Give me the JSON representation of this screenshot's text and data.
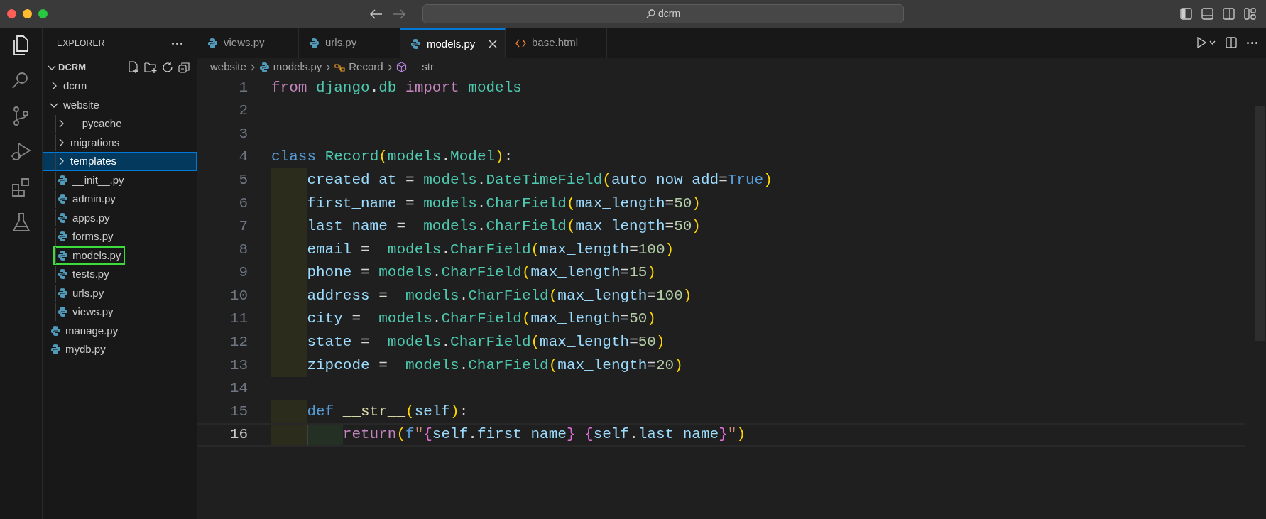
{
  "title_bar": {
    "search": "dcrm"
  },
  "activity_bar": [
    {
      "kind": "files",
      "selected": true
    },
    {
      "kind": "search",
      "selected": false
    },
    {
      "kind": "source-control",
      "selected": false
    },
    {
      "kind": "debug",
      "selected": false
    },
    {
      "kind": "extensions",
      "selected": false
    },
    {
      "kind": "testing",
      "selected": false
    }
  ],
  "sidebar": {
    "title": "EXPLORER",
    "section": {
      "label": "DCRM",
      "expanded": true
    },
    "tree": [
      {
        "kind": "folder",
        "label": "dcrm",
        "expanded": false,
        "selected": false
      },
      {
        "kind": "folder",
        "label": "website",
        "expanded": true,
        "selected": false,
        "children": [
          {
            "kind": "folder",
            "label": "__pycache__",
            "expanded": false,
            "selected": false
          },
          {
            "kind": "folder",
            "label": "migrations",
            "expanded": false,
            "selected": false
          },
          {
            "kind": "folder",
            "label": "templates",
            "expanded": false,
            "selected": true
          },
          {
            "kind": "python",
            "label": "__init__.py",
            "selected": false
          },
          {
            "kind": "python",
            "label": "admin.py",
            "selected": false
          },
          {
            "kind": "python",
            "label": "apps.py",
            "selected": false
          },
          {
            "kind": "python",
            "label": "forms.py",
            "selected": false
          },
          {
            "kind": "python",
            "label": "models.py",
            "selected": false,
            "outlined": true
          },
          {
            "kind": "python",
            "label": "tests.py",
            "selected": false
          },
          {
            "kind": "python",
            "label": "urls.py",
            "selected": false
          },
          {
            "kind": "python",
            "label": "views.py",
            "selected": false
          }
        ]
      },
      {
        "kind": "python",
        "label": "manage.py",
        "selected": false
      },
      {
        "kind": "python",
        "label": "mydb.py",
        "selected": false
      }
    ]
  },
  "tabs": [
    {
      "kind": "python",
      "label": "views.py",
      "selected": false
    },
    {
      "kind": "python",
      "label": "urls.py",
      "selected": false
    },
    {
      "kind": "python",
      "label": "models.py",
      "selected": true
    },
    {
      "kind": "html",
      "label": "base.html",
      "selected": false
    }
  ],
  "breadcrumb": [
    {
      "kind": "folder",
      "label": "website"
    },
    {
      "kind": "python",
      "label": "models.py"
    },
    {
      "kind": "class",
      "label": "Record"
    },
    {
      "kind": "method",
      "label": "__str__"
    }
  ],
  "code": [
    {
      "number": "1",
      "current": false,
      "guide": false,
      "inner_guide": false,
      "tokens": [
        {
          "kind": "kw",
          "text": "from "
        },
        {
          "kind": "mod",
          "text": "django"
        },
        {
          "kind": "op",
          "text": "."
        },
        {
          "kind": "mod",
          "text": "db "
        },
        {
          "kind": "kw",
          "text": "import "
        },
        {
          "kind": "mod",
          "text": "models"
        }
      ]
    },
    {
      "number": "2",
      "current": false,
      "guide": false,
      "inner_guide": false
    },
    {
      "number": "3",
      "current": false,
      "guide": false,
      "inner_guide": false
    },
    {
      "number": "4",
      "current": false,
      "guide": false,
      "inner_guide": false,
      "tokens": [
        {
          "kind": "kw2",
          "text": "class "
        },
        {
          "kind": "mod",
          "text": "Record"
        },
        {
          "kind": "br1",
          "text": "("
        },
        {
          "kind": "mod",
          "text": "models"
        },
        {
          "kind": "op",
          "text": "."
        },
        {
          "kind": "mod",
          "text": "Model"
        },
        {
          "kind": "br1",
          "text": ")"
        },
        {
          "kind": "op",
          "text": ":"
        }
      ]
    },
    {
      "number": "5",
      "current": false,
      "guide": true,
      "inner_guide": false,
      "tokens": [
        {
          "kind": "var",
          "text": "created_at"
        },
        {
          "kind": "op",
          "text": " = "
        },
        {
          "kind": "mod",
          "text": "models"
        },
        {
          "kind": "op",
          "text": "."
        },
        {
          "kind": "mod",
          "text": "DateTimeField"
        },
        {
          "kind": "br1",
          "text": "("
        },
        {
          "kind": "var",
          "text": "auto_now_add"
        },
        {
          "kind": "op",
          "text": "="
        },
        {
          "kind": "kw2",
          "text": "True"
        },
        {
          "kind": "br1",
          "text": ")"
        }
      ]
    },
    {
      "number": "6",
      "current": false,
      "guide": true,
      "inner_guide": false,
      "tokens": [
        {
          "kind": "var",
          "text": "first_name"
        },
        {
          "kind": "op",
          "text": " = "
        },
        {
          "kind": "mod",
          "text": "models"
        },
        {
          "kind": "op",
          "text": "."
        },
        {
          "kind": "mod",
          "text": "CharField"
        },
        {
          "kind": "br1",
          "text": "("
        },
        {
          "kind": "var",
          "text": "max_length"
        },
        {
          "kind": "op",
          "text": "="
        },
        {
          "kind": "num",
          "text": "50"
        },
        {
          "kind": "br1",
          "text": ")"
        }
      ]
    },
    {
      "number": "7",
      "current": false,
      "guide": true,
      "inner_guide": false,
      "tokens": [
        {
          "kind": "var",
          "text": "last_name"
        },
        {
          "kind": "op",
          "text": " =  "
        },
        {
          "kind": "mod",
          "text": "models"
        },
        {
          "kind": "op",
          "text": "."
        },
        {
          "kind": "mod",
          "text": "CharField"
        },
        {
          "kind": "br1",
          "text": "("
        },
        {
          "kind": "var",
          "text": "max_length"
        },
        {
          "kind": "op",
          "text": "="
        },
        {
          "kind": "num",
          "text": "50"
        },
        {
          "kind": "br1",
          "text": ")"
        }
      ]
    },
    {
      "number": "8",
      "current": false,
      "guide": true,
      "inner_guide": false,
      "tokens": [
        {
          "kind": "var",
          "text": "email"
        },
        {
          "kind": "op",
          "text": " =  "
        },
        {
          "kind": "mod",
          "text": "models"
        },
        {
          "kind": "op",
          "text": "."
        },
        {
          "kind": "mod",
          "text": "CharField"
        },
        {
          "kind": "br1",
          "text": "("
        },
        {
          "kind": "var",
          "text": "max_length"
        },
        {
          "kind": "op",
          "text": "="
        },
        {
          "kind": "num",
          "text": "100"
        },
        {
          "kind": "br1",
          "text": ")"
        }
      ]
    },
    {
      "number": "9",
      "current": false,
      "guide": true,
      "inner_guide": false,
      "tokens": [
        {
          "kind": "var",
          "text": "phone"
        },
        {
          "kind": "op",
          "text": " = "
        },
        {
          "kind": "mod",
          "text": "models"
        },
        {
          "kind": "op",
          "text": "."
        },
        {
          "kind": "mod",
          "text": "CharField"
        },
        {
          "kind": "br1",
          "text": "("
        },
        {
          "kind": "var",
          "text": "max_length"
        },
        {
          "kind": "op",
          "text": "="
        },
        {
          "kind": "num",
          "text": "15"
        },
        {
          "kind": "br1",
          "text": ")"
        }
      ]
    },
    {
      "number": "10",
      "current": false,
      "guide": true,
      "inner_guide": false,
      "tokens": [
        {
          "kind": "var",
          "text": "address"
        },
        {
          "kind": "op",
          "text": " =  "
        },
        {
          "kind": "mod",
          "text": "models"
        },
        {
          "kind": "op",
          "text": "."
        },
        {
          "kind": "mod",
          "text": "CharField"
        },
        {
          "kind": "br1",
          "text": "("
        },
        {
          "kind": "var",
          "text": "max_length"
        },
        {
          "kind": "op",
          "text": "="
        },
        {
          "kind": "num",
          "text": "100"
        },
        {
          "kind": "br1",
          "text": ")"
        }
      ]
    },
    {
      "number": "11",
      "current": false,
      "guide": true,
      "inner_guide": false,
      "tokens": [
        {
          "kind": "var",
          "text": "city"
        },
        {
          "kind": "op",
          "text": " =  "
        },
        {
          "kind": "mod",
          "text": "models"
        },
        {
          "kind": "op",
          "text": "."
        },
        {
          "kind": "mod",
          "text": "CharField"
        },
        {
          "kind": "br1",
          "text": "("
        },
        {
          "kind": "var",
          "text": "max_length"
        },
        {
          "kind": "op",
          "text": "="
        },
        {
          "kind": "num",
          "text": "50"
        },
        {
          "kind": "br1",
          "text": ")"
        }
      ]
    },
    {
      "number": "12",
      "current": false,
      "guide": true,
      "inner_guide": false,
      "tokens": [
        {
          "kind": "var",
          "text": "state"
        },
        {
          "kind": "op",
          "text": " =  "
        },
        {
          "kind": "mod",
          "text": "models"
        },
        {
          "kind": "op",
          "text": "."
        },
        {
          "kind": "mod",
          "text": "CharField"
        },
        {
          "kind": "br1",
          "text": "("
        },
        {
          "kind": "var",
          "text": "max_length"
        },
        {
          "kind": "op",
          "text": "="
        },
        {
          "kind": "num",
          "text": "50"
        },
        {
          "kind": "br1",
          "text": ")"
        }
      ]
    },
    {
      "number": "13",
      "current": false,
      "guide": true,
      "inner_guide": false,
      "tokens": [
        {
          "kind": "var",
          "text": "zipcode"
        },
        {
          "kind": "op",
          "text": " =  "
        },
        {
          "kind": "mod",
          "text": "models"
        },
        {
          "kind": "op",
          "text": "."
        },
        {
          "kind": "mod",
          "text": "CharField"
        },
        {
          "kind": "br1",
          "text": "("
        },
        {
          "kind": "var",
          "text": "max_length"
        },
        {
          "kind": "op",
          "text": "="
        },
        {
          "kind": "num",
          "text": "20"
        },
        {
          "kind": "br1",
          "text": ")"
        }
      ]
    },
    {
      "number": "14",
      "current": false,
      "guide": false,
      "inner_guide": false
    },
    {
      "number": "15",
      "current": false,
      "guide": true,
      "inner_guide": false,
      "tokens": [
        {
          "kind": "kw2",
          "text": "def "
        },
        {
          "kind": "fn",
          "text": "__str__"
        },
        {
          "kind": "br1",
          "text": "("
        },
        {
          "kind": "var",
          "text": "self"
        },
        {
          "kind": "br1",
          "text": ")"
        },
        {
          "kind": "op",
          "text": ":"
        }
      ]
    },
    {
      "number": "16",
      "current": true,
      "guide": true,
      "inner_guide": true,
      "tokens": [
        {
          "kind": "kw",
          "text": "return"
        },
        {
          "kind": "br1",
          "text": "("
        },
        {
          "kind": "kw2",
          "text": "f"
        },
        {
          "kind": "str",
          "text": "\""
        },
        {
          "kind": "br2",
          "text": "{"
        },
        {
          "kind": "var",
          "text": "self"
        },
        {
          "kind": "op",
          "text": "."
        },
        {
          "kind": "var",
          "text": "first_name"
        },
        {
          "kind": "br2",
          "text": "} {"
        },
        {
          "kind": "var",
          "text": "self"
        },
        {
          "kind": "op",
          "text": "."
        },
        {
          "kind": "var",
          "text": "last_name"
        },
        {
          "kind": "br2",
          "text": "}"
        },
        {
          "kind": "str",
          "text": "\""
        },
        {
          "kind": "br1",
          "text": ")"
        }
      ]
    }
  ]
}
